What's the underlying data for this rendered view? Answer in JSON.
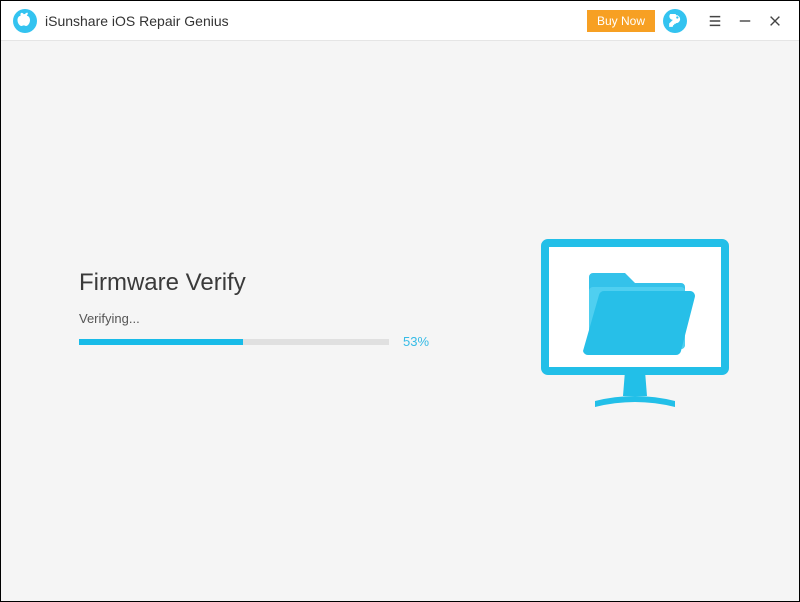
{
  "header": {
    "title": "iSunshare iOS Repair Genius",
    "buy_now_label": "Buy Now"
  },
  "main": {
    "heading": "Firmware Verify",
    "status": "Verifying...",
    "progress_pct": 53,
    "progress_label": "53%"
  },
  "colors": {
    "accent": "#18bbe8",
    "buy_now": "#f7a023"
  }
}
